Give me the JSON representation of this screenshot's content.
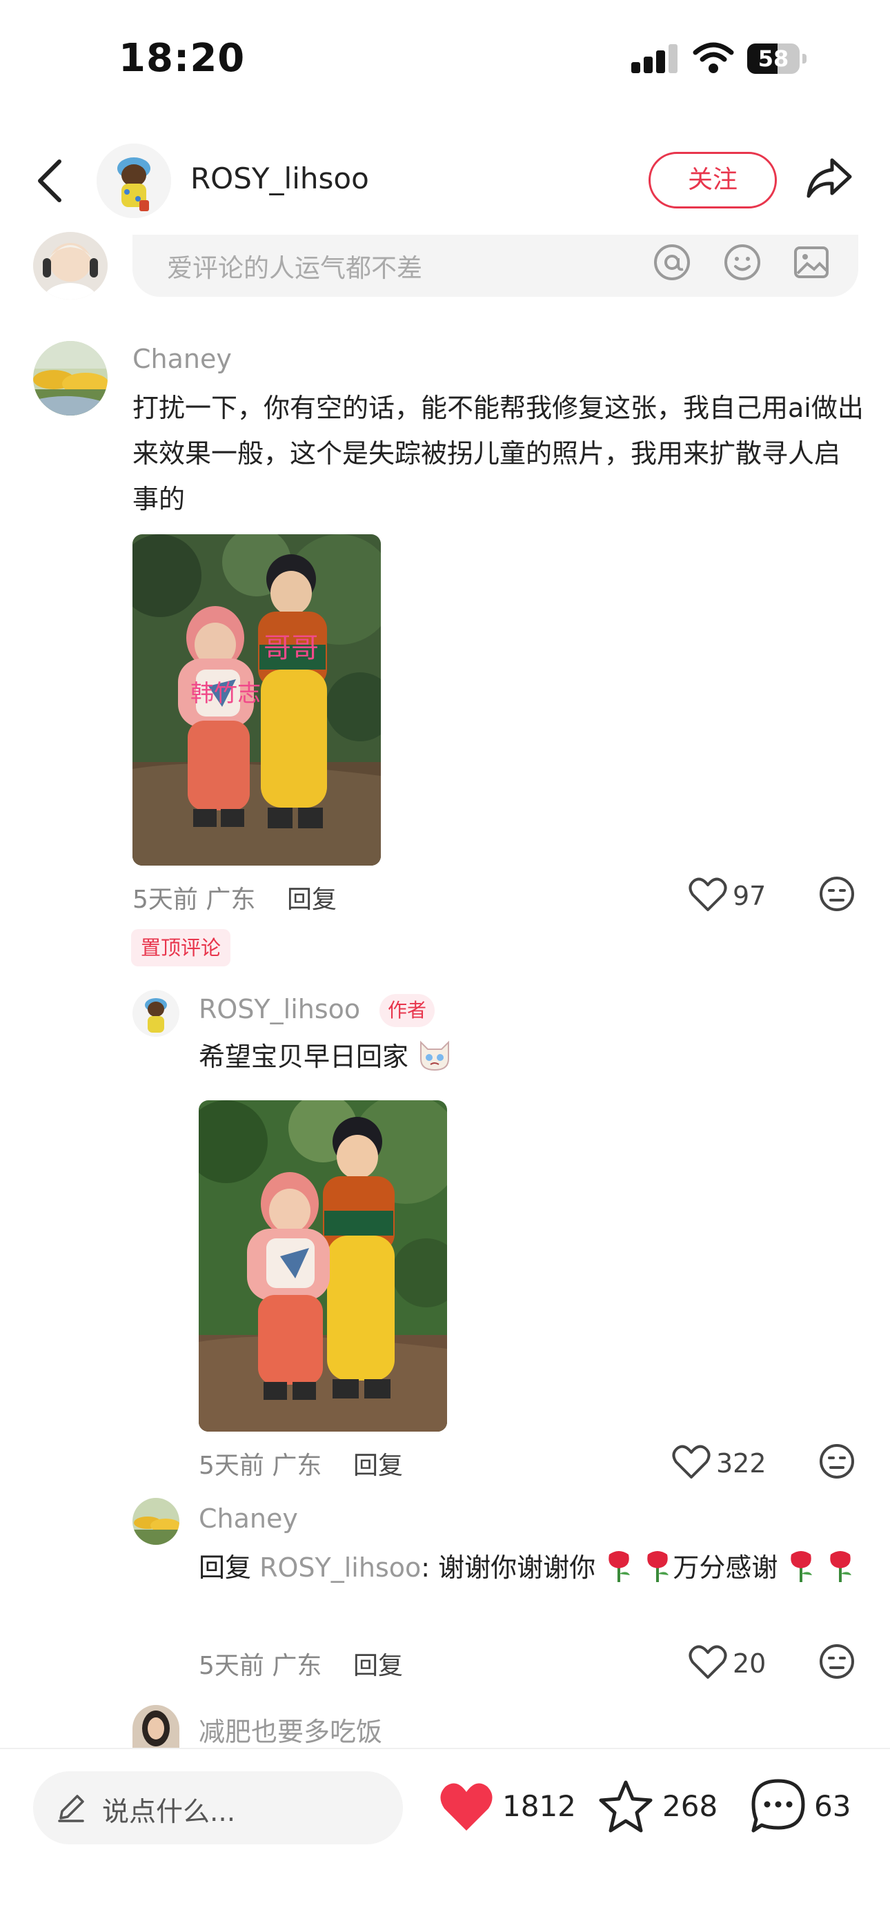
{
  "status_bar": {
    "time": "18:20",
    "battery": "58",
    "battery_level": 0.58
  },
  "header": {
    "username": "ROSY_lihsoo",
    "follow_label": "关注"
  },
  "comment_input": {
    "placeholder": "爱评论的人运气都不差"
  },
  "comments": [
    {
      "user": "Chaney",
      "text": "打扰一下，你有空的话，能不能帮我修复这张，我自己用ai做出来效果一般，这个是失踪被拐儿童的照片，我用来扩散寻人启事的",
      "photo_labels": [
        "哥哥",
        "韩竹志"
      ],
      "meta": "5天前 广东",
      "reply_label": "回复",
      "likes": "97",
      "pinned_label": "置顶评论"
    }
  ],
  "replies": [
    {
      "user": "ROSY_lihsoo",
      "author_tag": "作者",
      "text": "希望宝贝早日回家",
      "meta": "5天前 广东",
      "reply_label": "回复",
      "likes": "322"
    },
    {
      "user": "Chaney",
      "reply_prefix": "回复 ",
      "reply_target": "ROSY_lihsoo",
      "text_part1": ": 谢谢你谢谢你",
      "text_part2": "万分感谢",
      "meta": "5天前 广东",
      "reply_label": "回复",
      "likes": "20"
    },
    {
      "user": "减肥也要多吃饭"
    }
  ],
  "bottom_bar": {
    "placeholder": "说点什么...",
    "likes": "1812",
    "favorites": "268",
    "comments": "63"
  },
  "colors": {
    "accent": "#e8364d",
    "muted_text": "#999999",
    "input_bg": "#f4f4f4"
  },
  "icons": [
    "back-icon",
    "share-icon",
    "at-icon",
    "emoji-icon",
    "image-icon",
    "heart-icon",
    "dislike-face-icon",
    "pencil-icon",
    "heart-filled-icon",
    "star-icon",
    "comment-bubble-icon",
    "rose-icon",
    "crying-cat-emoji"
  ]
}
